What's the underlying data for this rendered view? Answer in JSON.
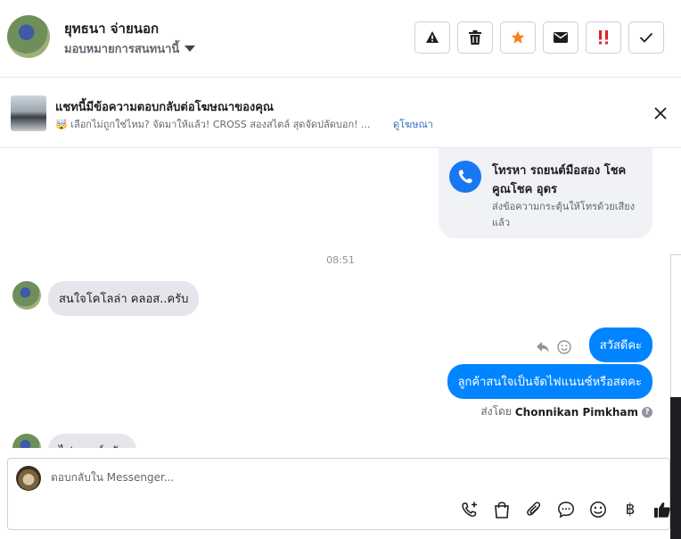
{
  "header": {
    "contact_name": "ยุทธนา จ่ายนอก",
    "assign_label": "มอบหมายการสนทนานี้",
    "actions": [
      {
        "name": "report",
        "icon": "warning-icon",
        "color": "#1c1e21"
      },
      {
        "name": "delete",
        "icon": "trash-icon",
        "color": "#1c1e21"
      },
      {
        "name": "star",
        "icon": "star-icon",
        "color": "#f5821f"
      },
      {
        "name": "mark-unread",
        "icon": "envelope-icon",
        "color": "#1c1e21"
      },
      {
        "name": "mark-important",
        "icon": "double-exclamation-icon",
        "color": "#e02020"
      },
      {
        "name": "mark-done",
        "icon": "checkmark-icon",
        "color": "#1c1e21"
      }
    ]
  },
  "ad_banner": {
    "title": "แชทนี้มีข้อความตอบกลับต่อโฆษณาของคุณ",
    "description": "🤯 เลือกไม่ถูกใช่ไหม? จัดมาให้แล้ว! CROSS สองสไตล์ สุดจัดปลัดบอก! ...",
    "link": "ดูโฆษณา"
  },
  "call_card": {
    "title": "โทรหา รถยนต์มือสอง โชคคูณโชค อุดร",
    "subtitle": "ส่งข้อความกระตุ้นให้โทรด้วยเสียงแล้ว"
  },
  "timestamp": "08:51",
  "messages": {
    "incoming_1": "สนใจโคโลล่า คลอส..ครับ",
    "outgoing_1": "สวัสดีคะ",
    "outgoing_2": "ลูกค้าสนใจเป็นจัดไฟแนนซ์หรือสดคะ",
    "incoming_2_partial": "ไฟแนนซ์ครับ"
  },
  "sent_by": {
    "prefix": "ส่งโดย",
    "name": "Chonnikan Pimkham",
    "help": "?"
  },
  "composer": {
    "placeholder": "ตอบกลับใน Messenger...",
    "tools": [
      {
        "name": "call-request",
        "icon": "phone-plus-icon"
      },
      {
        "name": "shop",
        "icon": "shopping-bag-icon"
      },
      {
        "name": "attach",
        "icon": "paperclip-icon"
      },
      {
        "name": "saved-replies",
        "icon": "chat-bubble-icon"
      },
      {
        "name": "emoji",
        "icon": "smiley-icon"
      },
      {
        "name": "payment",
        "icon": "baht-icon",
        "glyph": "฿"
      },
      {
        "name": "like",
        "icon": "thumbs-up-icon"
      }
    ]
  },
  "colors": {
    "accent": "#1877f2",
    "outgoing_bubble": "#0084ff",
    "incoming_bubble": "#e4e6eb"
  }
}
